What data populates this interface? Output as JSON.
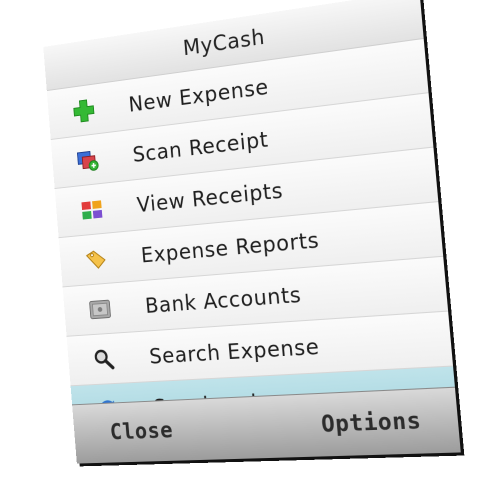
{
  "app": {
    "title": "MyCash"
  },
  "menu": {
    "items": [
      {
        "label": "New Expense",
        "icon": "plus-icon"
      },
      {
        "label": "Scan Receipt",
        "icon": "scan-receipt-icon"
      },
      {
        "label": "View Receipts",
        "icon": "grid-icon"
      },
      {
        "label": "Expense Reports",
        "icon": "tag-icon"
      },
      {
        "label": "Bank Accounts",
        "icon": "safe-icon"
      },
      {
        "label": "Search Expense",
        "icon": "search-icon"
      },
      {
        "label": "Synchronise",
        "icon": "sync-icon",
        "selected": true
      }
    ]
  },
  "softkeys": {
    "left_label": "Close",
    "right_label": "Options"
  },
  "colors": {
    "selected_row": "#a9d6df",
    "softkey_bar": "#b5b5b5",
    "plus_green": "#2db52d"
  }
}
